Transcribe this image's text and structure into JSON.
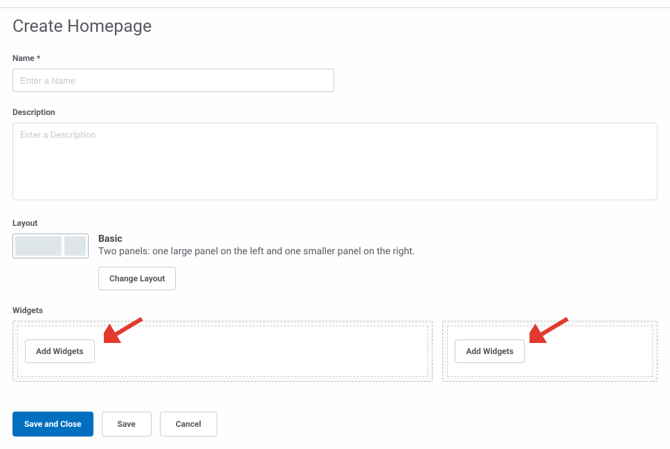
{
  "page": {
    "title": "Create Homepage"
  },
  "fields": {
    "name": {
      "label": "Name *",
      "placeholder": "Enter a Name",
      "value": ""
    },
    "description": {
      "label": "Description",
      "placeholder": "Enter a Description",
      "value": ""
    }
  },
  "layout": {
    "section_label": "Layout",
    "name": "Basic",
    "description": "Two panels: one large panel on the left and one smaller panel on the right.",
    "change_button": "Change Layout"
  },
  "widgets": {
    "section_label": "Widgets",
    "add_button": "Add Widgets"
  },
  "actions": {
    "save_close": "Save and Close",
    "save": "Save",
    "cancel": "Cancel"
  }
}
